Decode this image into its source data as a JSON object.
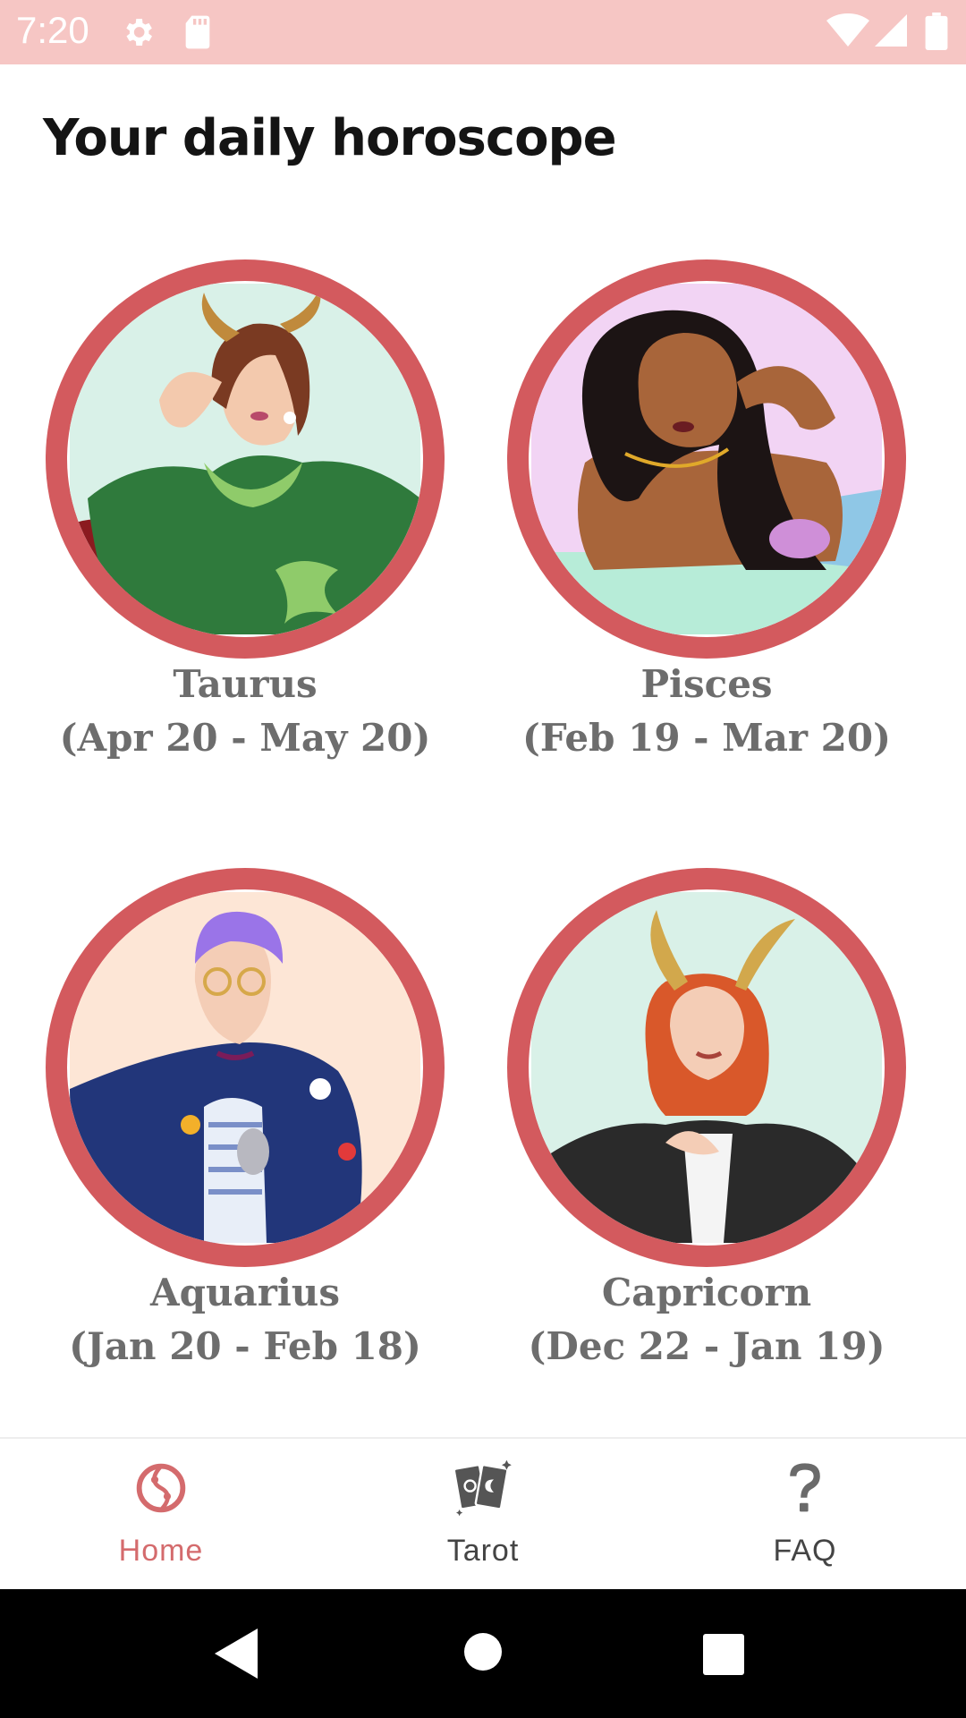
{
  "status_bar": {
    "time": "7:20",
    "background": "#f6c6c4",
    "left_icons": [
      "gear-icon",
      "sd-card-icon"
    ],
    "right_icons": [
      "wifi-icon",
      "signal-icon",
      "battery-icon"
    ]
  },
  "header": {
    "title": "Your daily horoscope"
  },
  "signs": [
    {
      "name": "Taurus",
      "dates": "(Apr 20 - May 20)",
      "bg": "#d9f1e8"
    },
    {
      "name": "Pisces",
      "dates": "(Feb 19 - Mar 20)",
      "bg": "#f2d4f4"
    },
    {
      "name": "Aquarius",
      "dates": "(Jan 20 - Feb 18)",
      "bg": "#fde6d6"
    },
    {
      "name": "Capricorn",
      "dates": "(Dec 22 - Jan 19)",
      "bg": "#d9f1e8"
    }
  ],
  "bottom_nav": {
    "items": [
      {
        "label": "Home",
        "icon": "home-icon",
        "active": true
      },
      {
        "label": "Tarot",
        "icon": "tarot-cards-icon",
        "active": false
      },
      {
        "label": "FAQ",
        "icon": "question-mark-icon",
        "active": false
      }
    ],
    "active_color": "#d46b6d",
    "inactive_color": "#444444"
  },
  "colors": {
    "accent": "#d35a5e",
    "title": "#141414",
    "sign_text": "#6d6d6d"
  }
}
